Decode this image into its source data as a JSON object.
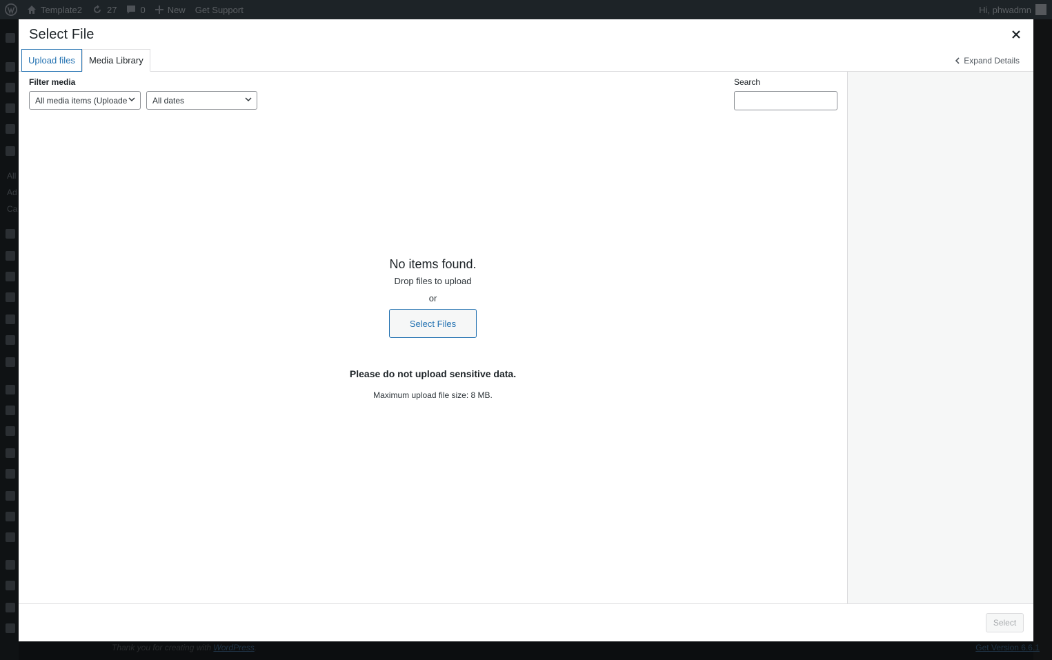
{
  "adminbar": {
    "site_name": "Template2",
    "updates_count": "27",
    "comments_count": "0",
    "new_label": "New",
    "support_label": "Get Support",
    "greeting": "Hi, phwadmn"
  },
  "background": {
    "menu_partial": [
      "All",
      "Ad",
      "Ca"
    ],
    "footer_text": "Thank you for creating with",
    "footer_link": "WordPress",
    "footer_version": "Get Version 6.6.1"
  },
  "modal": {
    "title": "Select File",
    "tabs": [
      {
        "label": "Upload files"
      },
      {
        "label": "Media Library"
      }
    ],
    "expand_details": "Expand Details",
    "filter_label": "Filter media",
    "type_filter_value": "All media items (Uploade",
    "date_filter_value": "All dates",
    "search_label": "Search",
    "search_value": "",
    "empty": {
      "no_items": "No items found.",
      "drop": "Drop files to upload",
      "or": "or",
      "select_files": "Select Files",
      "warning": "Please do not upload sensitive data.",
      "max_size": "Maximum upload file size: 8 MB."
    },
    "select_button": "Select"
  },
  "colors": {
    "accent": "#2271b1",
    "admin_bar": "#1d2327",
    "sidebar_pane": "#f6f7f7"
  }
}
